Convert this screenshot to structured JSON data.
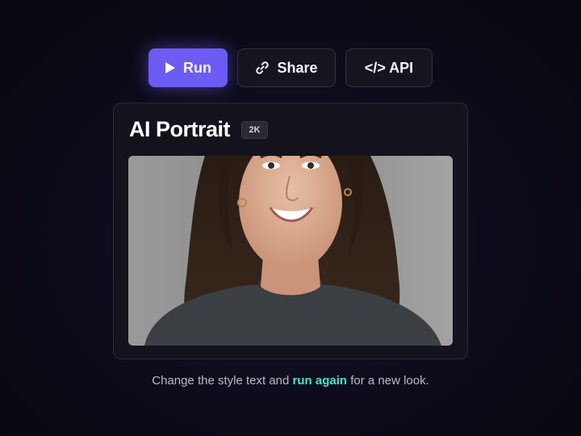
{
  "toolbar": {
    "run_label": "Run",
    "share_label": "Share",
    "api_label": "</> API",
    "run_icon": "play-icon",
    "share_icon": "link-icon"
  },
  "card": {
    "title": "AI Portrait",
    "badge": "2K",
    "image_icon": "portrait-photo"
  },
  "caption": {
    "before": "Change the style text and ",
    "highlight": "run again",
    "after": " for a new look."
  },
  "colors": {
    "accent": "#6c5cf3",
    "highlight": "#4fe0c8",
    "background": "#0c0b19"
  }
}
